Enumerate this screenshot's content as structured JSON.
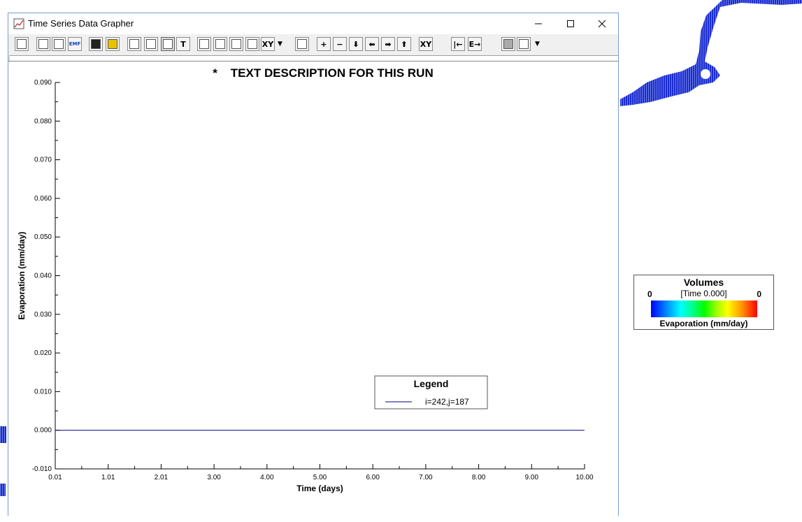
{
  "window": {
    "title": "Time Series Data Grapher",
    "controls": [
      "minimize-icon",
      "maximize-icon",
      "close-icon"
    ]
  },
  "toolbar": {
    "buttons": [
      {
        "name": "exit-icon"
      },
      {
        "name": "copy-icon"
      },
      {
        "name": "print-icon"
      },
      {
        "name": "emf-export-icon",
        "label": "EMF"
      },
      {
        "name": "save-icon"
      },
      {
        "name": "open-folder-icon"
      },
      {
        "name": "grid-icon"
      },
      {
        "name": "camera-icon"
      },
      {
        "name": "chart-style-icon",
        "pressed": true
      },
      {
        "name": "text-icon",
        "label": "T"
      },
      {
        "name": "plot-settings-icon"
      },
      {
        "name": "x-axis-icon"
      },
      {
        "name": "y-axis-icon"
      },
      {
        "name": "y-axis-alt-icon"
      },
      {
        "name": "xy-dropdown-icon",
        "label": "XY"
      },
      {
        "name": "legend-icon"
      },
      {
        "name": "zoom-in-icon",
        "label": "+"
      },
      {
        "name": "zoom-out-icon",
        "label": "−"
      },
      {
        "name": "arrow-down-icon",
        "label": "⬇"
      },
      {
        "name": "arrow-left-icon",
        "label": "⬅"
      },
      {
        "name": "arrow-right-icon",
        "label": "➡"
      },
      {
        "name": "arrow-up-icon",
        "label": "⬆"
      },
      {
        "name": "xy-scale-icon",
        "label": "XY"
      },
      {
        "name": "start-icon",
        "label": "|←"
      },
      {
        "name": "end-icon",
        "label": "E→"
      },
      {
        "name": "disabled-icon"
      },
      {
        "name": "color-icon"
      }
    ]
  },
  "chart_data": {
    "type": "line",
    "title": "*    TEXT DESCRIPTION FOR THIS RUN",
    "xlabel": "Time (days)",
    "ylabel": "Evaporation (mm/day)",
    "xlim": [
      0.01,
      10.0
    ],
    "ylim": [
      -0.01,
      0.09
    ],
    "xticks": [
      "0.01",
      "1.01",
      "2.01",
      "3.00",
      "4.00",
      "5.00",
      "6.00",
      "7.00",
      "8.00",
      "9.00",
      "10.00"
    ],
    "yticks": [
      "-0.010",
      "0.000",
      "0.010",
      "0.020",
      "0.030",
      "0.040",
      "0.050",
      "0.060",
      "0.070",
      "0.080",
      "0.090"
    ],
    "legend_title": "Legend",
    "legend_placement": "bottom-right",
    "grid": false,
    "series": [
      {
        "name": "i=242,j=187",
        "color": "#000080",
        "x": [
          0.01,
          10.0
        ],
        "y": [
          0.0,
          0.0
        ]
      }
    ]
  },
  "volumes_legend": {
    "title": "Volumes",
    "time_label": "[Time 0.000]",
    "min_value": "0",
    "max_value": "0",
    "variable_label": "Evaporation (mm/day)"
  },
  "colors": {
    "map_fill": "#1a2bd0",
    "window_border": "#7a9cc9",
    "series": "#000080"
  }
}
